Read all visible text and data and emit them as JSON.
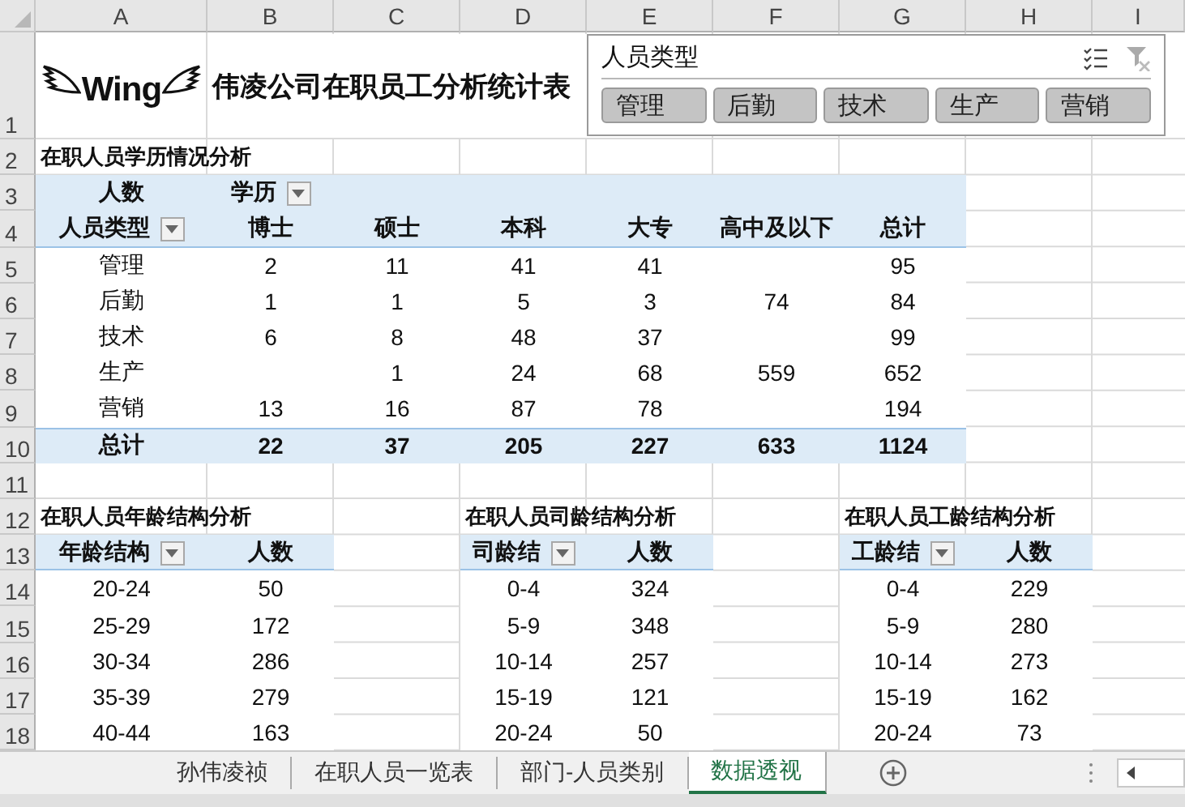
{
  "columns": [
    "A",
    "B",
    "C",
    "D",
    "E",
    "F",
    "G",
    "H",
    "I"
  ],
  "row_numbers": [
    "1",
    "2",
    "3",
    "4",
    "5",
    "6",
    "7",
    "8",
    "9",
    "10",
    "11",
    "12",
    "13",
    "14",
    "15",
    "16",
    "17",
    "18"
  ],
  "logo": {
    "text": "Wing"
  },
  "title": "伟凌公司在职员工分析统计表",
  "slicer": {
    "title": "人员类型",
    "items": [
      {
        "label": "管理",
        "selected": true
      },
      {
        "label": "后勤",
        "selected": true
      },
      {
        "label": "技术",
        "selected": true
      },
      {
        "label": "生产",
        "selected": true
      },
      {
        "label": "营销",
        "selected": true
      }
    ]
  },
  "education_pivot": {
    "title": "在职人员学历情况分析",
    "value_label": "人数",
    "column_field": "学历",
    "row_field": "人员类型",
    "columns": [
      "博士",
      "硕士",
      "本科",
      "大专",
      "高中及以下",
      "总计"
    ],
    "rows": [
      {
        "label": "管理",
        "values": [
          {
            "kind": "number",
            "text": "2"
          },
          {
            "kind": "number",
            "text": "11"
          },
          {
            "kind": "number",
            "text": "41"
          },
          {
            "kind": "number",
            "text": "41"
          },
          {
            "kind": "blank"
          },
          {
            "kind": "number",
            "text": "95"
          }
        ]
      },
      {
        "label": "后勤",
        "values": [
          {
            "kind": "number",
            "text": "1"
          },
          {
            "kind": "number",
            "text": "1"
          },
          {
            "kind": "number",
            "text": "5"
          },
          {
            "kind": "number",
            "text": "3"
          },
          {
            "kind": "number",
            "text": "74"
          },
          {
            "kind": "number",
            "text": "84"
          }
        ]
      },
      {
        "label": "技术",
        "values": [
          {
            "kind": "number",
            "text": "6"
          },
          {
            "kind": "number",
            "text": "8"
          },
          {
            "kind": "number",
            "text": "48"
          },
          {
            "kind": "number",
            "text": "37"
          },
          {
            "kind": "blank"
          },
          {
            "kind": "number",
            "text": "99"
          }
        ]
      },
      {
        "label": "生产",
        "values": [
          {
            "kind": "blank"
          },
          {
            "kind": "number",
            "text": "1"
          },
          {
            "kind": "number",
            "text": "24"
          },
          {
            "kind": "number",
            "text": "68"
          },
          {
            "kind": "number",
            "text": "559"
          },
          {
            "kind": "number",
            "text": "652"
          }
        ]
      },
      {
        "label": "营销",
        "values": [
          {
            "kind": "number",
            "text": "13"
          },
          {
            "kind": "number",
            "text": "16"
          },
          {
            "kind": "number",
            "text": "87"
          },
          {
            "kind": "number",
            "text": "78"
          },
          {
            "kind": "blank"
          },
          {
            "kind": "number",
            "text": "194"
          }
        ]
      }
    ],
    "total": {
      "label": "总计",
      "values": [
        "22",
        "37",
        "205",
        "227",
        "633",
        "1124"
      ]
    }
  },
  "small_pivots": [
    {
      "title": "在职人员年龄结构分析",
      "columns": [
        "年龄结构",
        "人数"
      ],
      "rows": [
        [
          "20-24",
          "50"
        ],
        [
          "25-29",
          "172"
        ],
        [
          "30-34",
          "286"
        ],
        [
          "35-39",
          "279"
        ],
        [
          "40-44",
          "163"
        ]
      ]
    },
    {
      "title": "在职人员司龄结构分析",
      "columns": [
        "司龄结",
        "人数"
      ],
      "rows": [
        [
          "0-4",
          "324"
        ],
        [
          "5-9",
          "348"
        ],
        [
          "10-14",
          "257"
        ],
        [
          "15-19",
          "121"
        ],
        [
          "20-24",
          "50"
        ]
      ]
    },
    {
      "title": "在职人员工龄结构分析",
      "columns": [
        "工龄结",
        "人数"
      ],
      "rows": [
        [
          "0-4",
          "229"
        ],
        [
          "5-9",
          "280"
        ],
        [
          "10-14",
          "273"
        ],
        [
          "15-19",
          "162"
        ],
        [
          "20-24",
          "73"
        ]
      ]
    }
  ],
  "sheet_tabs": [
    {
      "label": "孙伟凌祯",
      "selected": false
    },
    {
      "label": "在职人员一览表",
      "selected": false
    },
    {
      "label": "部门-人员类别",
      "selected": false
    },
    {
      "label": "数据透视",
      "selected": true
    }
  ]
}
